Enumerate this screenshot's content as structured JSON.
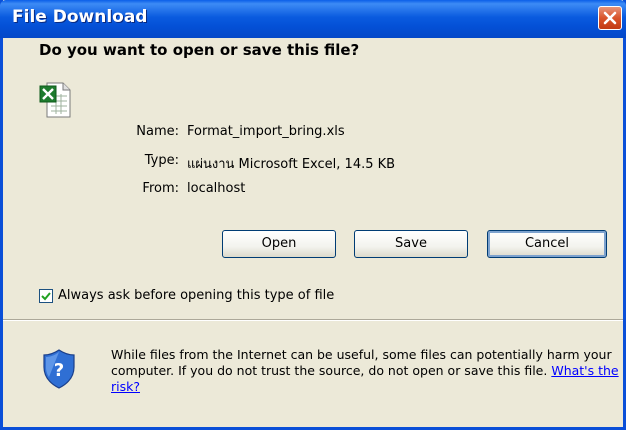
{
  "window": {
    "title": "File Download",
    "close_icon": "close-icon"
  },
  "dialog": {
    "question": "Do you want to open or save this file?",
    "file_icon": "excel-file-icon",
    "fields": {
      "name_label": "Name:",
      "name_value": "Format_import_bring.xls",
      "type_label": "Type:",
      "type_value": "แผ่นงาน Microsoft Excel, 14.5 KB",
      "from_label": "From:",
      "from_value": "localhost"
    },
    "buttons": {
      "open": "Open",
      "save": "Save",
      "cancel": "Cancel"
    },
    "always_ask": {
      "label": "Always ask before opening this type of file",
      "checked": true
    },
    "warning": {
      "icon": "security-shield-icon",
      "text": "While files from the Internet can be useful, some files can potentially harm your computer. If you do not trust the source, do not open or save this file.",
      "link": "What's the risk?"
    }
  },
  "colors": {
    "titlebar": "#0450D6",
    "dialog_bg": "#ECE9D8",
    "close_button": "#D9542A",
    "link": "#0000FF"
  }
}
